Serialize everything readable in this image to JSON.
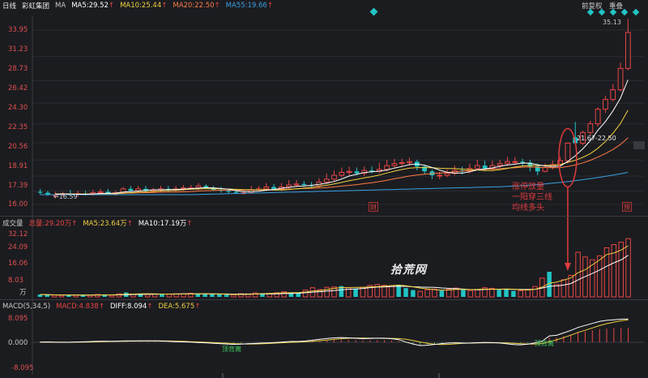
{
  "header": {
    "period": "日线",
    "stock_name": "彩虹集团",
    "ma_label": "MA",
    "ma5": "MA5:29.52",
    "ma10": "MA10:25.44",
    "ma20": "MA20:22.50",
    "ma55": "MA55:19.66",
    "up_arrow": "↑",
    "pre_adjust": "前复权",
    "overlay": "重叠",
    "colors": {
      "ma5": "#ffffff",
      "ma10": "#f0d040",
      "ma20": "#ff7a45",
      "ma55": "#3a9fe0",
      "up": "#e84545",
      "down": "#22c4c4"
    }
  },
  "price_axis": [
    "33.95",
    "31.23",
    "28.73",
    "26.42",
    "24.30",
    "22.35",
    "20.56",
    "18.91",
    "17.39",
    "16.00"
  ],
  "price_labels": {
    "low": "←16.59",
    "high": "35.13",
    "range": "21.67-22.50"
  },
  "tags": {
    "cai": "财",
    "yu": "预"
  },
  "annotation": {
    "line1": "涨停放量",
    "line2": "一阳穿三线",
    "line3": "均线多头"
  },
  "volume_bar": {
    "title": "成交量",
    "total": "总量:29.20万",
    "ma5": "MA5:23.64万",
    "ma10": "MA10:17.19万",
    "up_arrow": "↑"
  },
  "volume_axis": [
    "32.12",
    "24.09",
    "16.06",
    "8.03"
  ],
  "volume_unit": "万",
  "watermark": "拾荒网",
  "macd_bar": {
    "title": "MACD(5,34,5)",
    "macd": "MACD:4.838",
    "diff": "DIFF:8.094",
    "dea": "DEA:5.675",
    "up_arrow": "↑"
  },
  "macd_axis": [
    "8.095",
    "0.000",
    "-8.095"
  ],
  "macd_labels": {
    "div1": "顶背离",
    "div2": "顶背离"
  },
  "candle_data": {
    "type": "candlestick",
    "open": [
      17.3,
      17.2,
      17.0,
      17.0,
      17.1,
      17.0,
      17.1,
      17.0,
      17.2,
      17.3,
      17.1,
      17.2,
      17.6,
      17.4,
      17.6,
      17.4,
      17.5,
      17.6,
      17.5,
      17.6,
      17.7,
      17.7,
      17.9,
      17.7,
      17.5,
      17.4,
      17.3,
      17.2,
      17.2,
      17.5,
      17.6,
      17.8,
      17.6,
      17.8,
      18.0,
      18.1,
      18.0,
      17.9,
      18.3,
      18.6,
      19.0,
      19.3,
      19.4,
      19.2,
      19.5,
      19.4,
      19.6,
      20.0,
      20.2,
      20.3,
      20.4,
      19.9,
      19.4,
      19.0,
      19.0,
      19.2,
      19.5,
      19.4,
      19.7,
      20.0,
      19.7,
      20.0,
      20.2,
      20.4,
      20.4,
      20.3,
      19.9,
      19.4,
      19.8,
      20.1,
      20.5,
      22.9,
      22.3,
      23.4,
      24.3,
      25.8,
      26.8,
      27.8,
      30.0
    ],
    "close": [
      17.2,
      17.0,
      17.0,
      17.1,
      17.0,
      17.1,
      17.0,
      17.2,
      17.3,
      17.1,
      17.2,
      17.6,
      17.4,
      17.6,
      17.4,
      17.5,
      17.6,
      17.5,
      17.6,
      17.7,
      17.7,
      17.9,
      17.7,
      17.5,
      17.4,
      17.3,
      17.2,
      17.2,
      17.5,
      17.6,
      17.8,
      17.6,
      17.8,
      18.0,
      18.1,
      18.0,
      17.9,
      18.3,
      18.6,
      19.0,
      19.3,
      19.4,
      19.2,
      19.5,
      19.4,
      19.6,
      20.0,
      20.2,
      20.3,
      20.4,
      19.9,
      19.4,
      19.0,
      19.0,
      19.2,
      19.5,
      19.4,
      19.7,
      20.0,
      19.7,
      20.0,
      20.2,
      20.4,
      20.4,
      20.3,
      19.9,
      19.4,
      19.8,
      20.1,
      20.5,
      22.3,
      22.3,
      23.4,
      24.3,
      25.8,
      26.8,
      27.8,
      30.0,
      33.7
    ],
    "high": [
      17.6,
      17.4,
      17.3,
      17.3,
      17.5,
      17.4,
      17.4,
      17.5,
      17.6,
      17.6,
      17.4,
      17.8,
      17.9,
      17.9,
      17.9,
      17.7,
      17.9,
      17.9,
      17.9,
      18.0,
      18.0,
      18.2,
      18.1,
      17.9,
      17.8,
      17.6,
      17.5,
      17.5,
      17.9,
      17.9,
      18.2,
      18.1,
      18.2,
      18.5,
      18.5,
      18.4,
      18.3,
      18.7,
      19.2,
      19.5,
      19.8,
      19.9,
      19.8,
      19.9,
      19.9,
      20.3,
      20.6,
      20.7,
      20.7,
      20.8,
      20.6,
      20.0,
      19.6,
      19.4,
      19.6,
      20.0,
      19.9,
      20.2,
      20.6,
      20.5,
      20.5,
      20.6,
      20.9,
      20.9,
      20.7,
      20.6,
      20.2,
      20.2,
      20.5,
      20.9,
      22.4,
      24.5,
      23.6,
      24.6,
      26.0,
      27.2,
      28.4,
      30.6,
      35.1
    ],
    "low": [
      17.0,
      16.9,
      16.6,
      16.8,
      16.9,
      16.8,
      16.9,
      16.9,
      17.0,
      17.0,
      16.9,
      17.1,
      17.3,
      17.2,
      17.3,
      17.2,
      17.3,
      17.3,
      17.3,
      17.4,
      17.5,
      17.5,
      17.6,
      17.4,
      17.2,
      17.1,
      17.1,
      17.0,
      17.1,
      17.3,
      17.4,
      17.5,
      17.4,
      17.6,
      17.8,
      17.8,
      17.7,
      17.7,
      18.1,
      18.4,
      18.8,
      19.0,
      19.0,
      18.9,
      19.2,
      19.2,
      19.4,
      19.8,
      19.9,
      20.0,
      19.5,
      19.1,
      18.6,
      18.6,
      18.8,
      19.0,
      19.1,
      19.2,
      19.5,
      19.4,
      19.5,
      19.8,
      20.0,
      20.1,
      19.9,
      19.4,
      19.0,
      19.3,
      19.6,
      19.9,
      20.2,
      22.3,
      22.1,
      23.1,
      24.0,
      25.4,
      26.6,
      27.6,
      29.8
    ]
  },
  "volume_data": {
    "type": "bar",
    "values": [
      1.2,
      1.0,
      0.9,
      0.8,
      1.0,
      0.9,
      0.8,
      1.0,
      1.2,
      1.1,
      0.9,
      1.5,
      2.2,
      1.4,
      1.6,
      1.2,
      1.4,
      1.6,
      1.3,
      1.5,
      1.6,
      1.8,
      1.5,
      1.6,
      1.3,
      1.2,
      1.1,
      1.0,
      1.6,
      1.5,
      2.0,
      1.8,
      1.7,
      2.1,
      2.6,
      2.2,
      1.9,
      3.4,
      4.6,
      3.6,
      4.8,
      5.0,
      5.4,
      4.6,
      4.2,
      4.8,
      5.8,
      6.2,
      5.8,
      5.6,
      6.0,
      4.4,
      3.4,
      2.8,
      3.6,
      3.9,
      3.2,
      3.8,
      4.4,
      3.7,
      3.2,
      3.6,
      4.6,
      4.3,
      3.6,
      3.8,
      3.0,
      3.1,
      3.8,
      5.2,
      9.4,
      12.6,
      6.2,
      8.6,
      10.8,
      22.4,
      20.0,
      18.6,
      20.6,
      24.6,
      26.2,
      27.4,
      29.2
    ]
  },
  "macd_data": {
    "type": "bar",
    "values": [
      0.05,
      0.04,
      -0.05,
      -0.1,
      -0.12,
      -0.08,
      -0.05,
      -0.02,
      0.03,
      0.05,
      0.02,
      0.08,
      0.12,
      0.15,
      0.18,
      0.2,
      0.22,
      0.2,
      0.18,
      0.15,
      0.12,
      0.1,
      0.06,
      0.02,
      -0.05,
      -0.12,
      -0.18,
      -0.25,
      -0.2,
      -0.12,
      -0.05,
      0.02,
      0.05,
      0.12,
      0.2,
      0.25,
      0.22,
      0.3,
      0.45,
      0.6,
      0.75,
      0.85,
      0.9,
      0.8,
      0.7,
      0.6,
      0.65,
      0.7,
      0.7,
      0.6,
      0.4,
      -0.1,
      -0.5,
      -0.8,
      -0.7,
      -0.5,
      -0.3,
      -0.15,
      -0.05,
      -0.1,
      -0.05,
      0.05,
      0.1,
      0.1,
      0.05,
      -0.1,
      -0.3,
      -0.35,
      -0.2,
      0.05,
      0.4,
      1.5,
      1.6,
      2.1,
      2.6,
      3.2,
      3.6,
      4.0,
      4.4,
      4.6,
      4.7,
      4.8,
      4.838
    ]
  }
}
